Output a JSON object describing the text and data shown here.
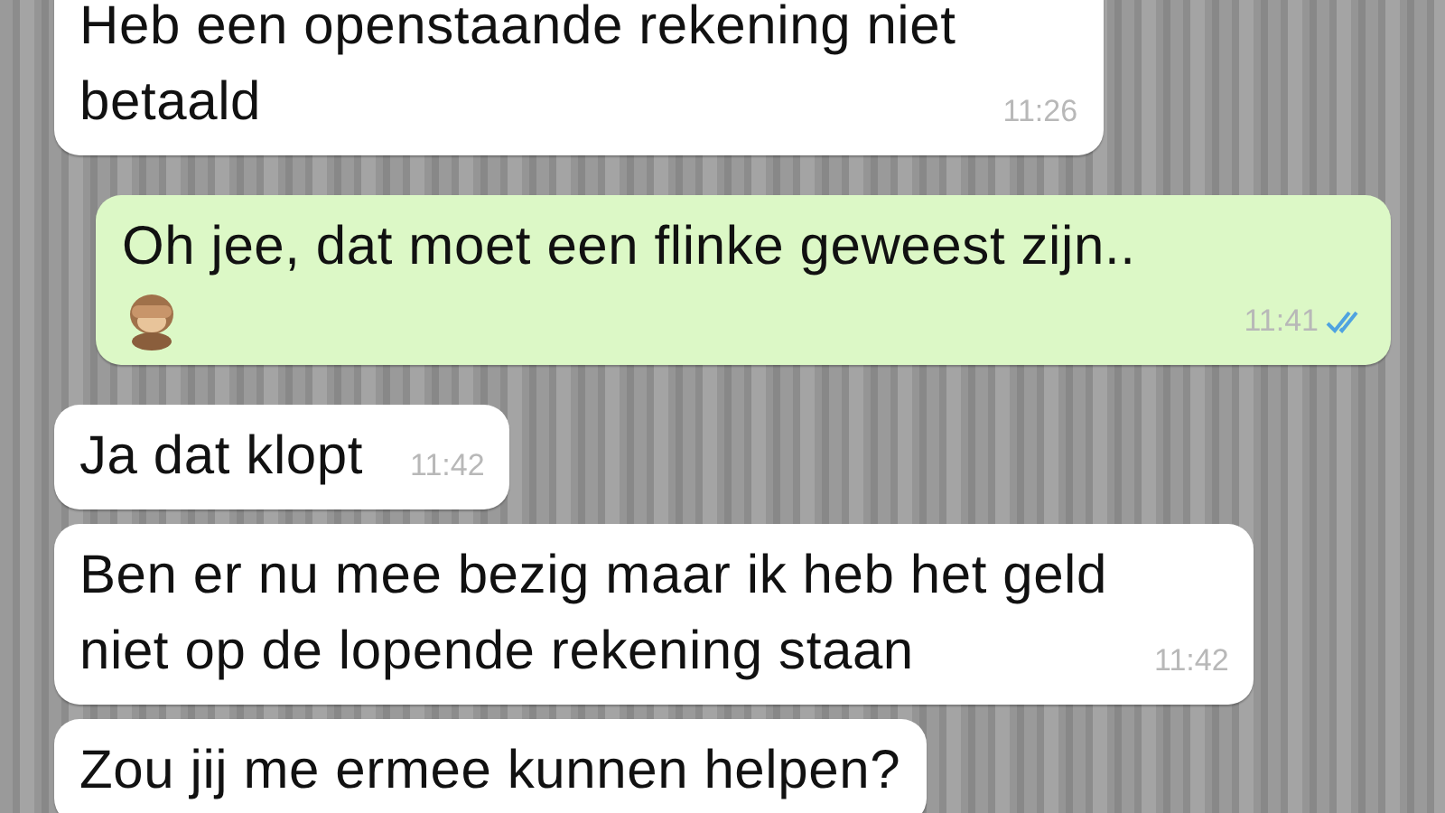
{
  "messages": [
    {
      "kind": "incoming",
      "text": "Heb een openstaande rekening niet\nbetaald",
      "time": "11:26"
    },
    {
      "kind": "outgoing",
      "text": "Oh jee, dat moet een flinke geweest zijn..",
      "emoji": true,
      "time": "11:41",
      "read": true
    },
    {
      "kind": "incoming",
      "text": "Ja dat klopt",
      "time": "11:42"
    },
    {
      "kind": "incoming",
      "text": "Ben er nu mee bezig maar ik heb het geld\nniet op de lopende rekening staan",
      "time": "11:42"
    },
    {
      "kind": "incoming",
      "text": "Zou jij me ermee kunnen helpen?"
    }
  ]
}
